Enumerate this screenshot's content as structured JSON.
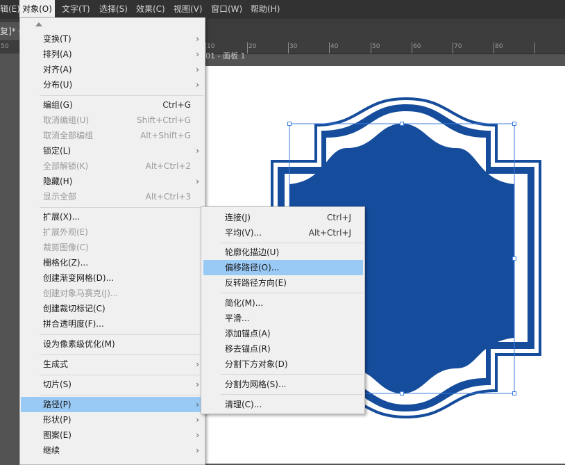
{
  "menubar": {
    "items": [
      "编辑(E)",
      "对象(O)",
      "文字(T)",
      "选择(S)",
      "效果(C)",
      "视图(V)",
      "窗口(W)",
      "帮助(H)"
    ]
  },
  "document": {
    "tab_label": "复]* ("
  },
  "ruler": {
    "labels": [
      "50",
      "10",
      "20",
      "30",
      "40",
      "50",
      "60",
      "70",
      "80"
    ]
  },
  "artboard": {
    "label": "01 - 画板 1"
  },
  "object_menu": {
    "items": [
      {
        "label": "变换(T)",
        "submenu": true
      },
      {
        "label": "排列(A)",
        "submenu": true
      },
      {
        "label": "对齐(A)",
        "submenu": true
      },
      {
        "label": "分布(U)",
        "submenu": true
      },
      {
        "label": "编组(G)",
        "shortcut": "Ctrl+G"
      },
      {
        "label": "取消编组(U)",
        "shortcut": "Shift+Ctrl+G",
        "disabled": true
      },
      {
        "label": "取消全部编组",
        "shortcut": "Alt+Shift+G",
        "disabled": true
      },
      {
        "label": "锁定(L)",
        "submenu": true
      },
      {
        "label": "全部解锁(K)",
        "shortcut": "Alt+Ctrl+2",
        "disabled": true
      },
      {
        "label": "隐藏(H)",
        "submenu": true
      },
      {
        "label": "显示全部",
        "shortcut": "Alt+Ctrl+3",
        "disabled": true
      },
      {
        "label": "扩展(X)..."
      },
      {
        "label": "扩展外观(E)",
        "disabled": true
      },
      {
        "label": "裁剪图像(C)",
        "disabled": true
      },
      {
        "label": "栅格化(Z)..."
      },
      {
        "label": "创建渐变网格(D)..."
      },
      {
        "label": "创建对象马赛克(J)...",
        "disabled": true
      },
      {
        "label": "创建裁切标记(C)"
      },
      {
        "label": "拼合透明度(F)..."
      },
      {
        "label": "设为像素级优化(M)"
      },
      {
        "label": "生成式",
        "submenu": true
      },
      {
        "label": "切片(S)",
        "submenu": true
      },
      {
        "label": "路径(P)",
        "submenu": true,
        "highlighted": true
      },
      {
        "label": "形状(P)",
        "submenu": true
      },
      {
        "label": "图案(E)",
        "submenu": true
      },
      {
        "label": "继续",
        "submenu": true
      }
    ]
  },
  "path_submenu": {
    "items": [
      {
        "label": "连接(J)",
        "shortcut": "Ctrl+J"
      },
      {
        "label": "平均(V)...",
        "shortcut": "Alt+Ctrl+J"
      },
      {
        "label": "轮廓化描边(U)"
      },
      {
        "label": "偏移路径(O)...",
        "highlighted": true
      },
      {
        "label": "反转路径方向(E)"
      },
      {
        "label": "简化(M)..."
      },
      {
        "label": "平滑..."
      },
      {
        "label": "添加锚点(A)"
      },
      {
        "label": "移去锚点(R)"
      },
      {
        "label": "分割下方对象(D)"
      },
      {
        "label": "分割为网格(S)..."
      },
      {
        "label": "清理(C)..."
      }
    ]
  },
  "colors": {
    "shape_blue": "#154c9c",
    "highlight": "#99c9f5",
    "selection_blue": "#3b7ddd"
  }
}
